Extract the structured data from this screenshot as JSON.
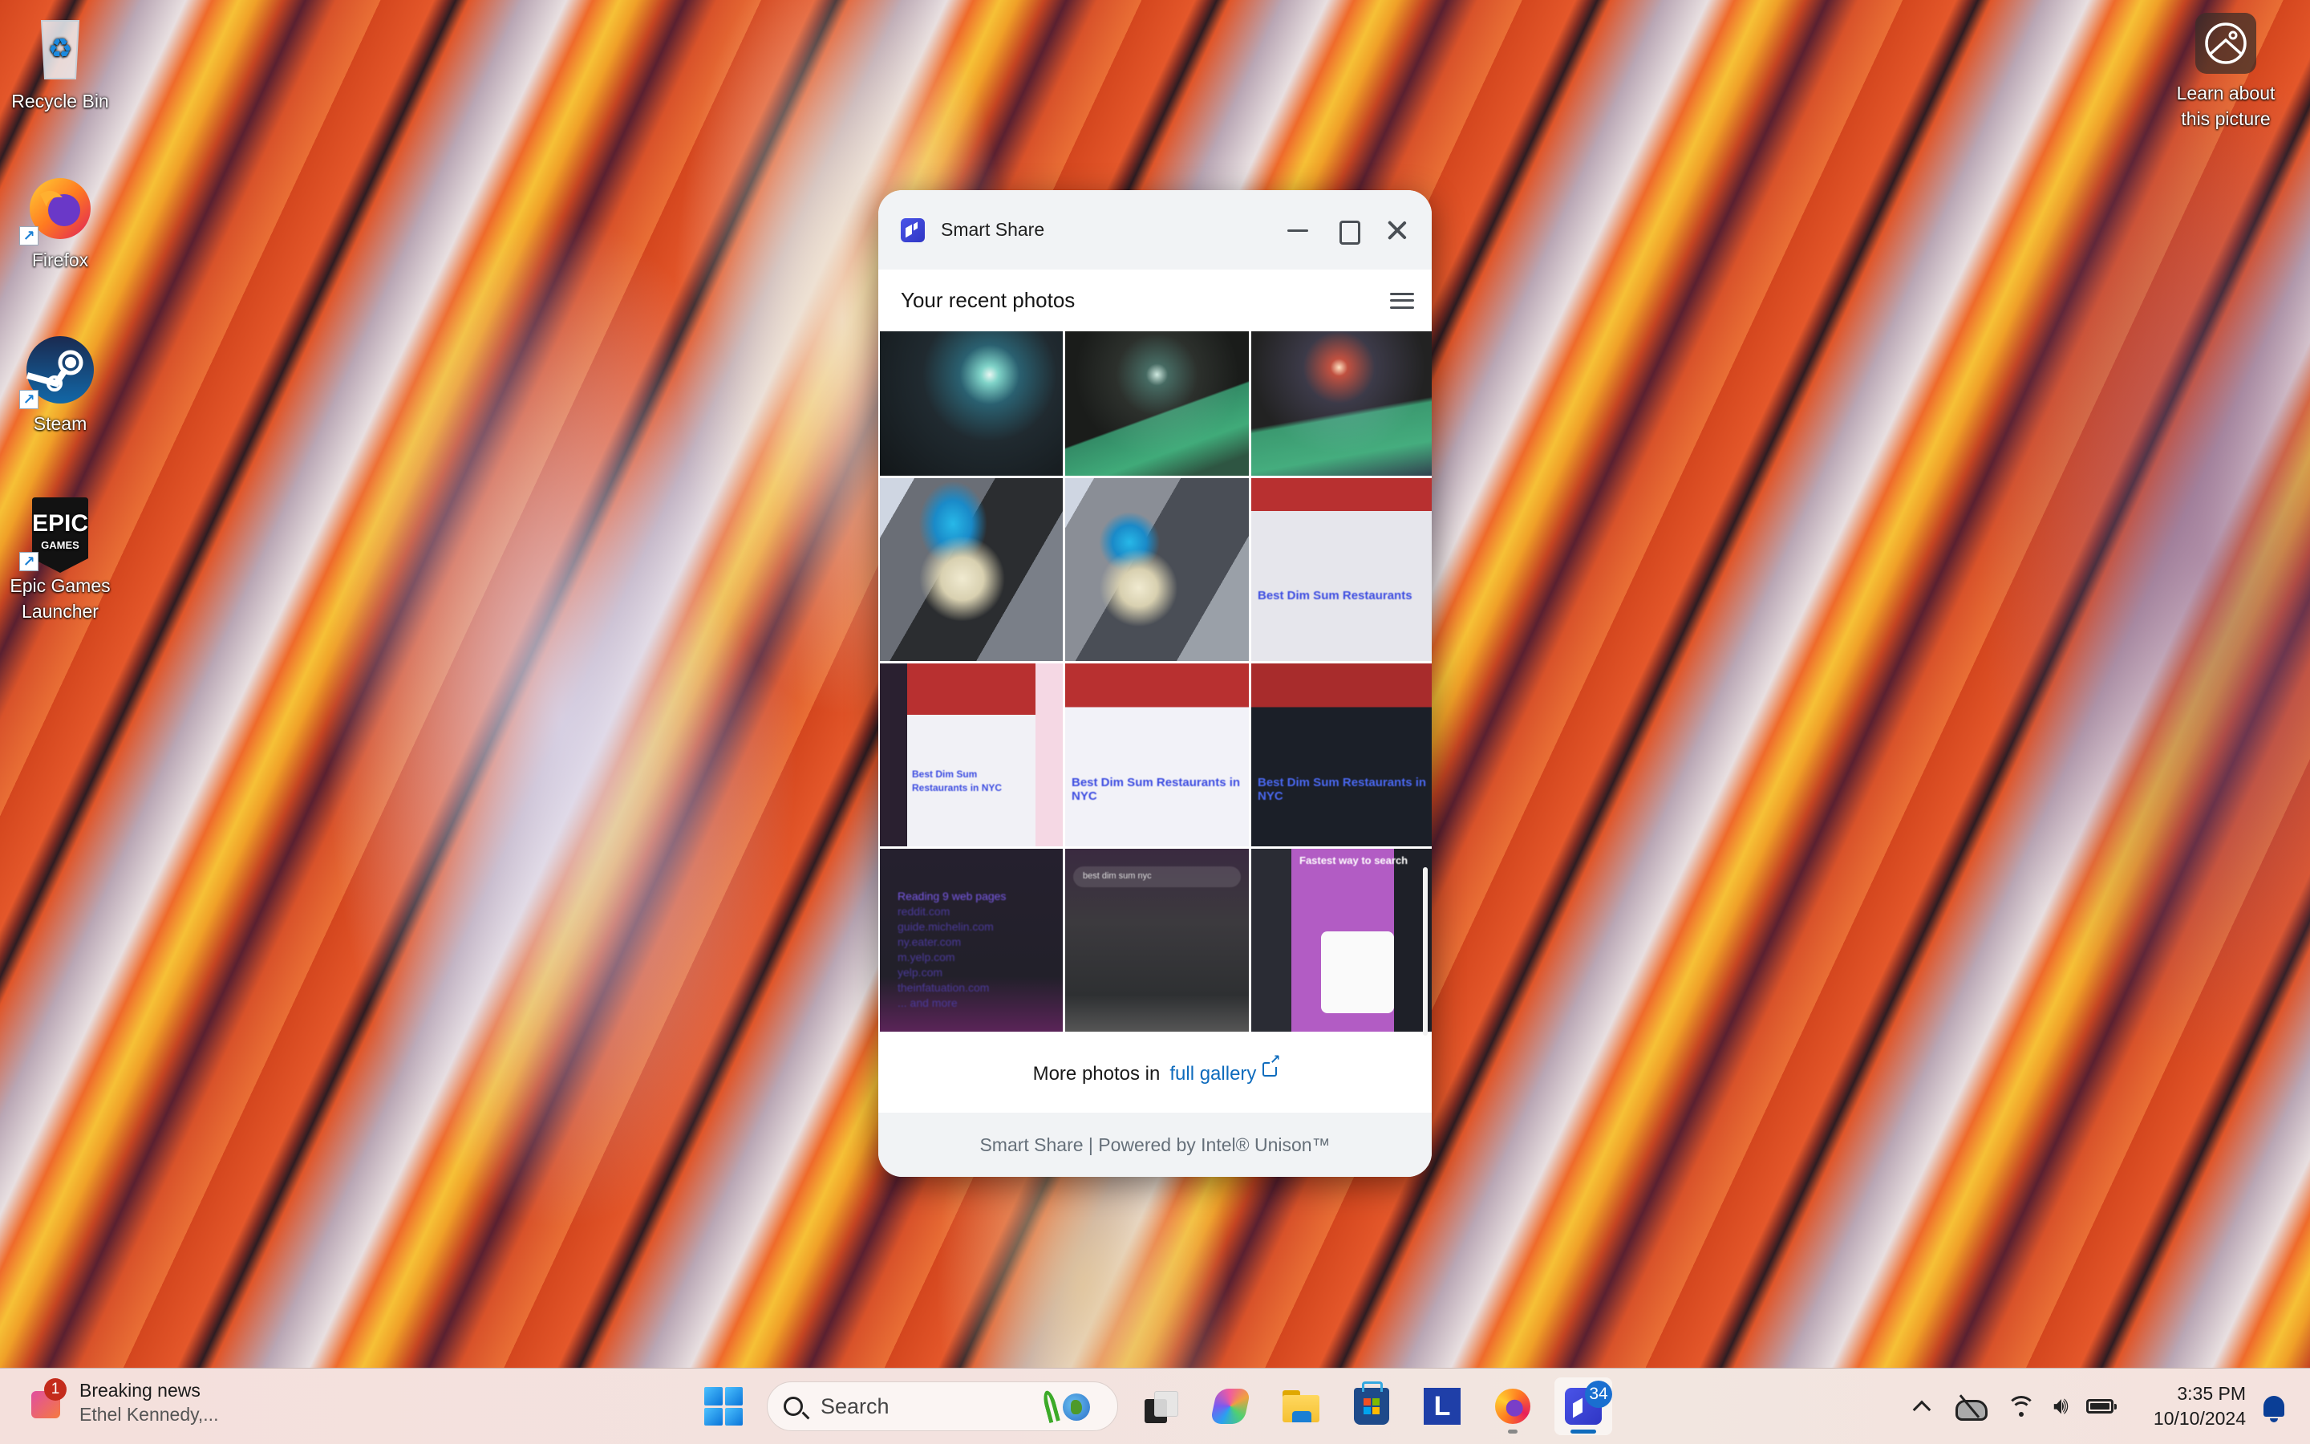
{
  "desktop": {
    "icons": [
      {
        "label": "Recycle Bin",
        "icon": "recycle-bin-icon"
      },
      {
        "label": "Firefox",
        "icon": "firefox-icon",
        "shortcut": true
      },
      {
        "label": "Steam",
        "icon": "steam-icon",
        "shortcut": true
      },
      {
        "label": "Epic Games Launcher",
        "icon": "epic-games-icon",
        "shortcut": true,
        "icon_text_top": "EPIC",
        "icon_text_bottom": "GAMES"
      },
      {
        "label": "Learn about this picture",
        "icon": "spotlight-icon"
      }
    ]
  },
  "window": {
    "title": "Smart Share",
    "accent": "#3a44d8",
    "controls": {
      "minimize": "minimize",
      "maximize": "maximize",
      "close": "close"
    },
    "section_title": "Your recent photos",
    "photos": [
      {
        "description": "traffic light with starburst lights in bar"
      },
      {
        "description": "dark bar with pool tables"
      },
      {
        "description": "pool hall with neon lights"
      },
      {
        "description": "troll doll with blue hair"
      },
      {
        "description": "troll doll with blue hair (alternate)"
      },
      {
        "description": "screenshot: Best Dim Sum Restaurants search",
        "caption": "Best Dim Sum Restaurants"
      },
      {
        "description": "screenshot: dim sum search results",
        "caption": "Best Dim Sum Restaurants in NYC"
      },
      {
        "description": "screenshot: dim sum search results light",
        "caption": "Best Dim Sum Restaurants in NYC"
      },
      {
        "description": "screenshot: dim sum search results dark",
        "caption": "Best Dim Sum Restaurants in NYC"
      },
      {
        "description": "screenshot: Reading 9 web pages",
        "lines": [
          "Reading 9 web pages",
          "reddit.com",
          "guide.michelin.com",
          "ny.eater.com",
          "m.yelp.com",
          "yelp.com",
          "theinfatuation.com",
          "... and more"
        ]
      },
      {
        "description": "screenshot: search suggestions",
        "search_text": "best dim sum nyc"
      },
      {
        "description": "screenshot: browser promo",
        "caption": "Fastest way to search"
      }
    ],
    "more_prefix": "More photos in",
    "more_link": "full gallery",
    "footer": "Smart Share | Powered by Intel® Unison™"
  },
  "taskbar": {
    "news": {
      "badge": "1",
      "title": "Breaking news",
      "subtitle": "Ethel Kennedy,..."
    },
    "search_placeholder": "Search",
    "apps": [
      {
        "name": "task-view"
      },
      {
        "name": "copilot"
      },
      {
        "name": "file-explorer"
      },
      {
        "name": "microsoft-store"
      },
      {
        "name": "l-app",
        "letter": "L"
      },
      {
        "name": "firefox",
        "running": true
      },
      {
        "name": "smart-share",
        "active": true,
        "badge": "34"
      }
    ],
    "tray": {
      "time": "3:35 PM",
      "date": "10/10/2024"
    }
  }
}
